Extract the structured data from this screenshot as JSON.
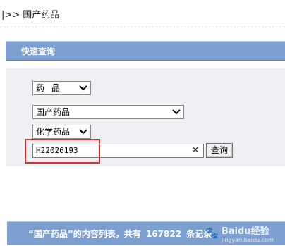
{
  "breadcrumb": {
    "text": "|>> 国产药品"
  },
  "quick_search": {
    "title": "快速查询"
  },
  "form": {
    "type_select": "药品",
    "category_select": "国产药品",
    "subcategory_select": "化学药品",
    "code_input_value": "H22026193",
    "clear_symbol": "✕",
    "query_button": "查询"
  },
  "results": {
    "part1": "“国产药品”的内容列表，共有",
    "count": "167822",
    "part2": "条记录"
  },
  "watermark": {
    "brand": "Baidu经验",
    "url": "jingyan.baidu.com"
  },
  "colors": {
    "header_blue": "#7d9fd0",
    "highlight_red": "#d7312b",
    "panel_gray": "#eef0f3"
  }
}
